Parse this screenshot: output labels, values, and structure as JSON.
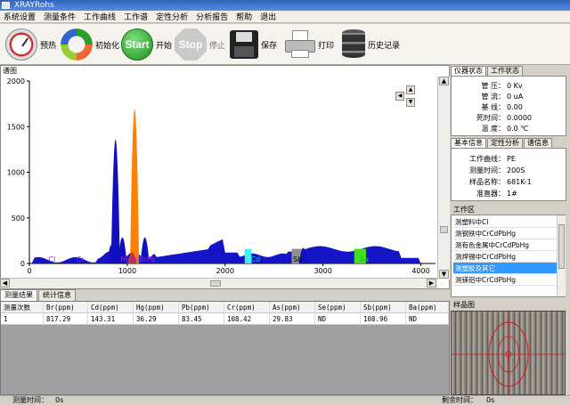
{
  "window": {
    "title": "XRAYRohs"
  },
  "menu": [
    "系统设置",
    "测量条件",
    "工作曲线",
    "工作谱",
    "定性分析",
    "分析报告",
    "帮助",
    "退出"
  ],
  "toolbar": {
    "preheat": "预热",
    "init": "初始化",
    "start_icon": "Start",
    "start": "开始",
    "stop_icon": "Stop",
    "stop": "停止",
    "save": "保存",
    "print": "打印",
    "history": "历史记录"
  },
  "spectrum": {
    "title": "谱图"
  },
  "chart_data": {
    "type": "area",
    "x_ticks": [
      "0",
      "1000",
      "2000",
      "3000",
      "4000"
    ],
    "y_ticks": [
      "0",
      "500",
      "1000",
      "1500",
      "2000"
    ],
    "xlim": [
      0,
      4150
    ],
    "ylim": [
      0,
      2000
    ],
    "peaks": [
      {
        "x": 880,
        "y": 1430,
        "color": "#1010c0"
      },
      {
        "x": 840,
        "y": 220,
        "color": "#1010c0"
      },
      {
        "x": 950,
        "y": 300,
        "color": "#1010c0"
      },
      {
        "x": 1075,
        "y": 1780,
        "color": "#ff8000"
      },
      {
        "x": 1050,
        "y": 130,
        "color": "#cc3030"
      },
      {
        "x": 1180,
        "y": 300,
        "color": "#1010c0"
      },
      {
        "x": 2800,
        "y": 180,
        "color": "#1010c0"
      }
    ],
    "element_labels": [
      {
        "text": "Cl",
        "x": 230,
        "color": "#9030c0"
      },
      {
        "text": "Cr",
        "x": 520,
        "color": "#9030c0"
      },
      {
        "text": "HgAsBrPb",
        "x": 1110,
        "color": "#9030c0"
      },
      {
        "text": "Cd",
        "x": 2310,
        "color": "#00c8d0"
      },
      {
        "text": "Sb",
        "x": 2740,
        "color": "#000000"
      },
      {
        "text": "Ba",
        "x": 3420,
        "color": "#30c030"
      }
    ],
    "regions": [
      {
        "x1": 2200,
        "x2": 2270,
        "color": "#40f0f0"
      },
      {
        "x1": 2680,
        "x2": 2790,
        "color": "#909090"
      },
      {
        "x1": 3320,
        "x2": 3440,
        "color": "#40e020"
      }
    ]
  },
  "results": {
    "tabs": [
      "测量结果",
      "统计信息"
    ],
    "columns": [
      "测量次数",
      "Br(ppm)",
      "Cd(ppm)",
      "Hg(ppm)",
      "Pb(ppm)",
      "Cr(ppm)",
      "As(ppm)",
      "Se(ppm)",
      "Sb(ppm)",
      "Ba(ppm)"
    ],
    "rows": [
      [
        "1",
        "817.29",
        "143.31",
        "36.29",
        "83.45",
        "108.42",
        "29.83",
        "ND",
        "108.96",
        "ND"
      ]
    ]
  },
  "status": {
    "measure_time_label": "测量时间：",
    "measure_time_value": "0s",
    "remaining_label": "剩余时间：",
    "remaining_value": "0s"
  },
  "instrument": {
    "tabs": [
      "仪器状态",
      "工作状态"
    ],
    "rows": [
      {
        "k": "管  压：",
        "v": "0 Kv"
      },
      {
        "k": "管  流：",
        "v": "0 uA"
      },
      {
        "k": "基  线：",
        "v": "0.00"
      },
      {
        "k": "死时间：",
        "v": "0.0000"
      },
      {
        "k": "温  度：",
        "v": "0.0 ℃"
      }
    ]
  },
  "basic": {
    "tabs": [
      "基本信息",
      "定性分析",
      "谱信息"
    ],
    "rows": [
      {
        "k": "工作曲线：",
        "v": "PE"
      },
      {
        "k": "测量时间：",
        "v": "200S"
      },
      {
        "k": "样品名称：",
        "v": "681K-1"
      },
      {
        "k": "准直器：",
        "v": "1#"
      }
    ]
  },
  "worklist": {
    "title": "工作区",
    "items": [
      "测塑料中Cl",
      "测钢铁中CrCdPbHg",
      "测有色金属中CrCdPbHg",
      "测焊锡中CrCdPbHg",
      "测塑胶及其它",
      "测镁铝中CrCdPbHg"
    ],
    "selected_index": 4
  },
  "sample": {
    "title": "样品图"
  }
}
